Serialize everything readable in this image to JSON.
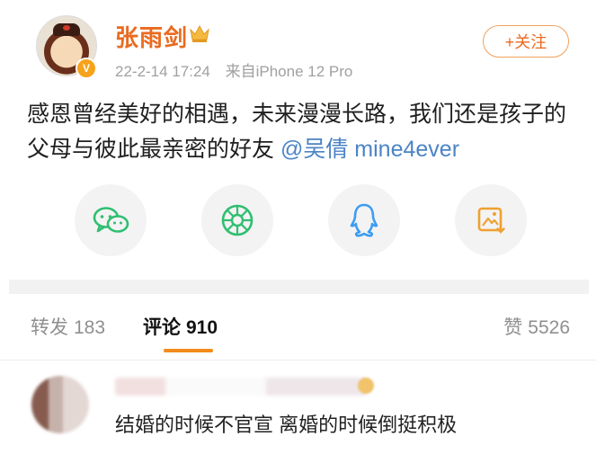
{
  "post": {
    "author": "张雨剑",
    "date": "22-2-14 17:24",
    "source": "来自iPhone 12 Pro",
    "follow_label": "+关注",
    "text": "感恩曾经美好的相遇，未来漫漫长路，我们还是孩子的父母与彼此最亲密的好友",
    "mention": "@吴倩 mine4ever"
  },
  "share_icons": [
    "wechat-icon",
    "moments-icon",
    "qq-icon",
    "save-image-icon"
  ],
  "tabs": {
    "repost": {
      "label": "转发",
      "count": "183"
    },
    "comment": {
      "label": "评论",
      "count": "910"
    },
    "like": {
      "label": "赞",
      "count": "5526"
    }
  },
  "comment": {
    "text": "结婚的时候不官宣 离婚的时候倒挺积极"
  },
  "colors": {
    "accent": "#ea6a1f",
    "mention": "#4b84c5",
    "share_icon": "#2fbf71",
    "qq_icon": "#3b9cf2",
    "save_icon": "#f0a030"
  }
}
